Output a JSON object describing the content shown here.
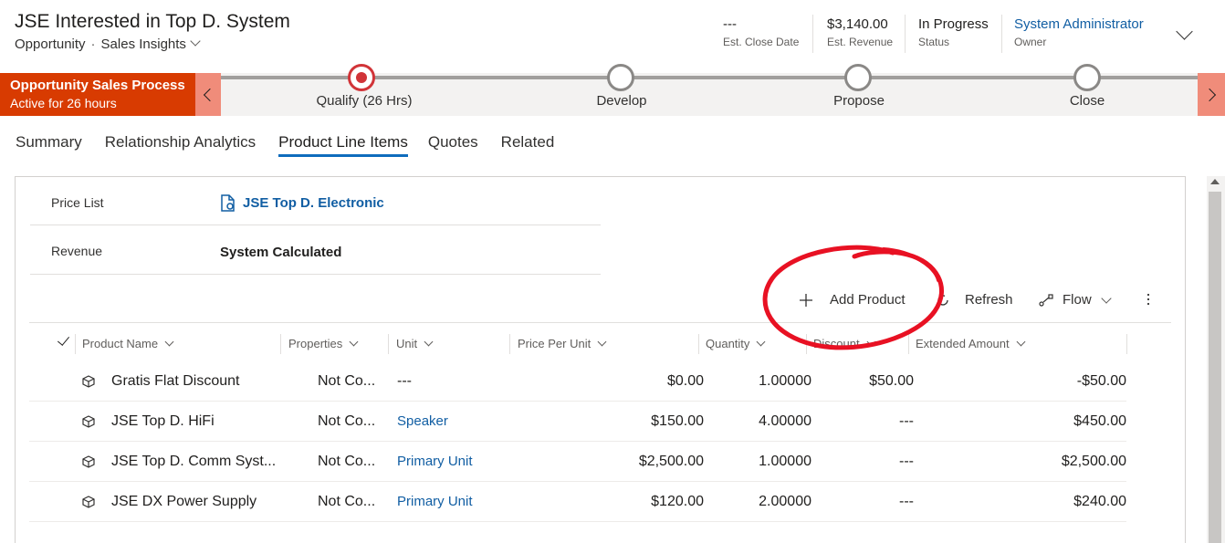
{
  "header": {
    "title": "JSE Interested in Top D. System",
    "entity": "Opportunity",
    "form": "Sales Insights",
    "fields": [
      {
        "value": "---",
        "label": "Est. Close Date"
      },
      {
        "value": "$3,140.00",
        "label": "Est. Revenue"
      },
      {
        "value": "In Progress",
        "label": "Status"
      },
      {
        "value": "System Administrator",
        "label": "Owner"
      }
    ]
  },
  "process": {
    "name": "Opportunity Sales Process",
    "status": "Active for 26 hours",
    "stages": [
      "Qualify  (26 Hrs)",
      "Develop",
      "Propose",
      "Close"
    ],
    "active_stage": 0
  },
  "tabs": [
    "Summary",
    "Relationship Analytics",
    "Product Line Items",
    "Quotes",
    "Related"
  ],
  "active_tab": 2,
  "fields": {
    "price_list_label": "Price List",
    "price_list_value": "JSE Top D. Electronic",
    "revenue_label": "Revenue",
    "revenue_value": "System Calculated"
  },
  "commands": {
    "add_product": "Add Product",
    "refresh": "Refresh",
    "flow": "Flow"
  },
  "grid": {
    "columns": [
      "Product Name",
      "Properties",
      "Unit",
      "Price Per Unit",
      "Quantity",
      "Discount",
      "Extended Amount"
    ],
    "rows": [
      {
        "name": "Gratis Flat Discount",
        "properties": "Not Co...",
        "unit": "---",
        "unit_link": false,
        "price": "$0.00",
        "quantity": "1.00000",
        "discount": "$50.00",
        "extended": "-$50.00"
      },
      {
        "name": "JSE Top D. HiFi",
        "properties": "Not Co...",
        "unit": "Speaker",
        "unit_link": true,
        "price": "$150.00",
        "quantity": "4.00000",
        "discount": "---",
        "extended": "$450.00"
      },
      {
        "name": "JSE Top D. Comm Syst...",
        "properties": "Not Co...",
        "unit": "Primary Unit",
        "unit_link": true,
        "price": "$2,500.00",
        "quantity": "1.00000",
        "discount": "---",
        "extended": "$2,500.00"
      },
      {
        "name": "JSE DX Power Supply",
        "properties": "Not Co...",
        "unit": "Primary Unit",
        "unit_link": true,
        "price": "$120.00",
        "quantity": "2.00000",
        "discount": "---",
        "extended": "$240.00"
      }
    ]
  },
  "colors": {
    "process_accent": "#d83b01",
    "link": "#115ea3",
    "annotation": "#e81123"
  }
}
